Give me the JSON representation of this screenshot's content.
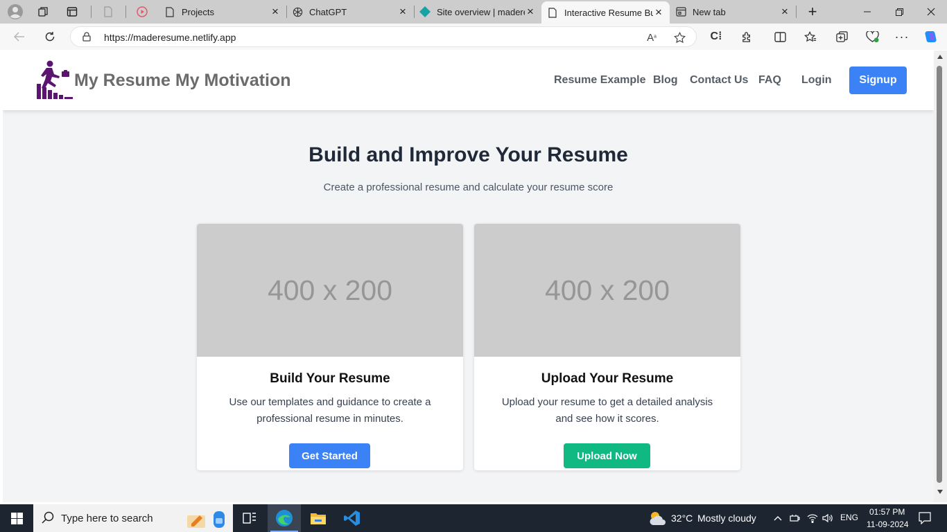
{
  "browser": {
    "tabs": [
      {
        "title": "Projects",
        "icon": "page-icon"
      },
      {
        "title": "ChatGPT",
        "icon": "chatgpt-icon"
      },
      {
        "title": "Site overview | madere",
        "icon": "netlify-icon"
      },
      {
        "title": "Interactive Resume Buil",
        "icon": "page-icon",
        "active": true
      },
      {
        "title": "New tab",
        "icon": "newtab-icon"
      }
    ],
    "url": "https://maderesume.netlify.app"
  },
  "site": {
    "brand": "My Resume My Motivation",
    "nav": [
      "Resume Example",
      "Blog",
      "Contact Us",
      "FAQ"
    ],
    "login": "Login",
    "signup": "Signup",
    "colors": {
      "primary": "#3b82f6",
      "success": "#10b981",
      "logo": "#5b1570"
    }
  },
  "hero": {
    "title": "Build and Improve Your Resume",
    "subtitle": "Create a professional resume and calculate your resume score"
  },
  "cards": [
    {
      "placeholder": "400 x 200",
      "title": "Build Your Resume",
      "description": "Use our templates and guidance to create a professional resume in minutes.",
      "button": "Get Started"
    },
    {
      "placeholder": "400 x 200",
      "title": "Upload Your Resume",
      "description": "Upload your resume to get a detailed analysis and see how it scores.",
      "button": "Upload Now"
    }
  ],
  "taskbar": {
    "search_placeholder": "Type here to search",
    "temperature": "32°C",
    "weather": "Mostly cloudy",
    "language": "ENG",
    "time": "01:57 PM",
    "date": "11-09-2024"
  }
}
